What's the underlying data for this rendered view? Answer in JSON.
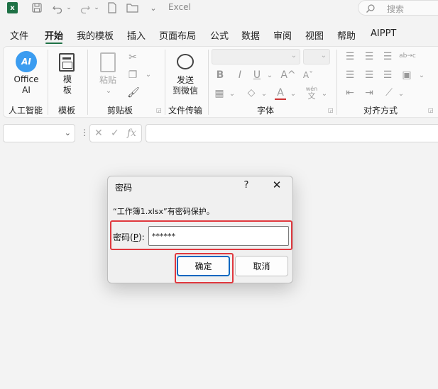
{
  "titlebar": {
    "app_name": "Excel",
    "logo_letter": "x",
    "search_label": "搜索"
  },
  "menu": {
    "tabs": [
      "文件",
      "开始",
      "我的模板",
      "插入",
      "页面布局",
      "公式",
      "数据",
      "审阅",
      "视图",
      "帮助",
      "AIPPT"
    ],
    "active_tab": "开始"
  },
  "ribbon": {
    "ai_button": {
      "icon_text": "AI",
      "label_line1": "Office",
      "label_line2": "AI"
    },
    "template_button": {
      "label_line1": "模",
      "label_line2": "板"
    },
    "paste_button": {
      "label": "粘贴"
    },
    "send_button": {
      "label_line1": "发送",
      "label_line2": "到微信"
    },
    "groups": [
      "人工智能",
      "模板",
      "剪贴板",
      "文件传输",
      "字体",
      "对齐方式"
    ],
    "font_icons": {
      "bold": "B",
      "italic": "I",
      "underline": "U",
      "grow": "A^",
      "shrink": "Aˇ",
      "font_color": "A",
      "phonetic_top": "wén",
      "phonetic_bottom": "文"
    },
    "align_icons": {
      "wrap": "ab→c"
    }
  },
  "formula_bar": {
    "name_box_value": "",
    "fx_label": "fx",
    "formula_value": ""
  },
  "dialog": {
    "title": "密码",
    "help_label": "?",
    "close_label": "✕",
    "message": "“工作簿1.xlsx”有密码保护。",
    "password_label_pre": "密码(",
    "password_label_key": "P",
    "password_label_post": "):",
    "password_value": "******",
    "ok_label": "确定",
    "cancel_label": "取消",
    "highlight_color": "#e0383e"
  }
}
